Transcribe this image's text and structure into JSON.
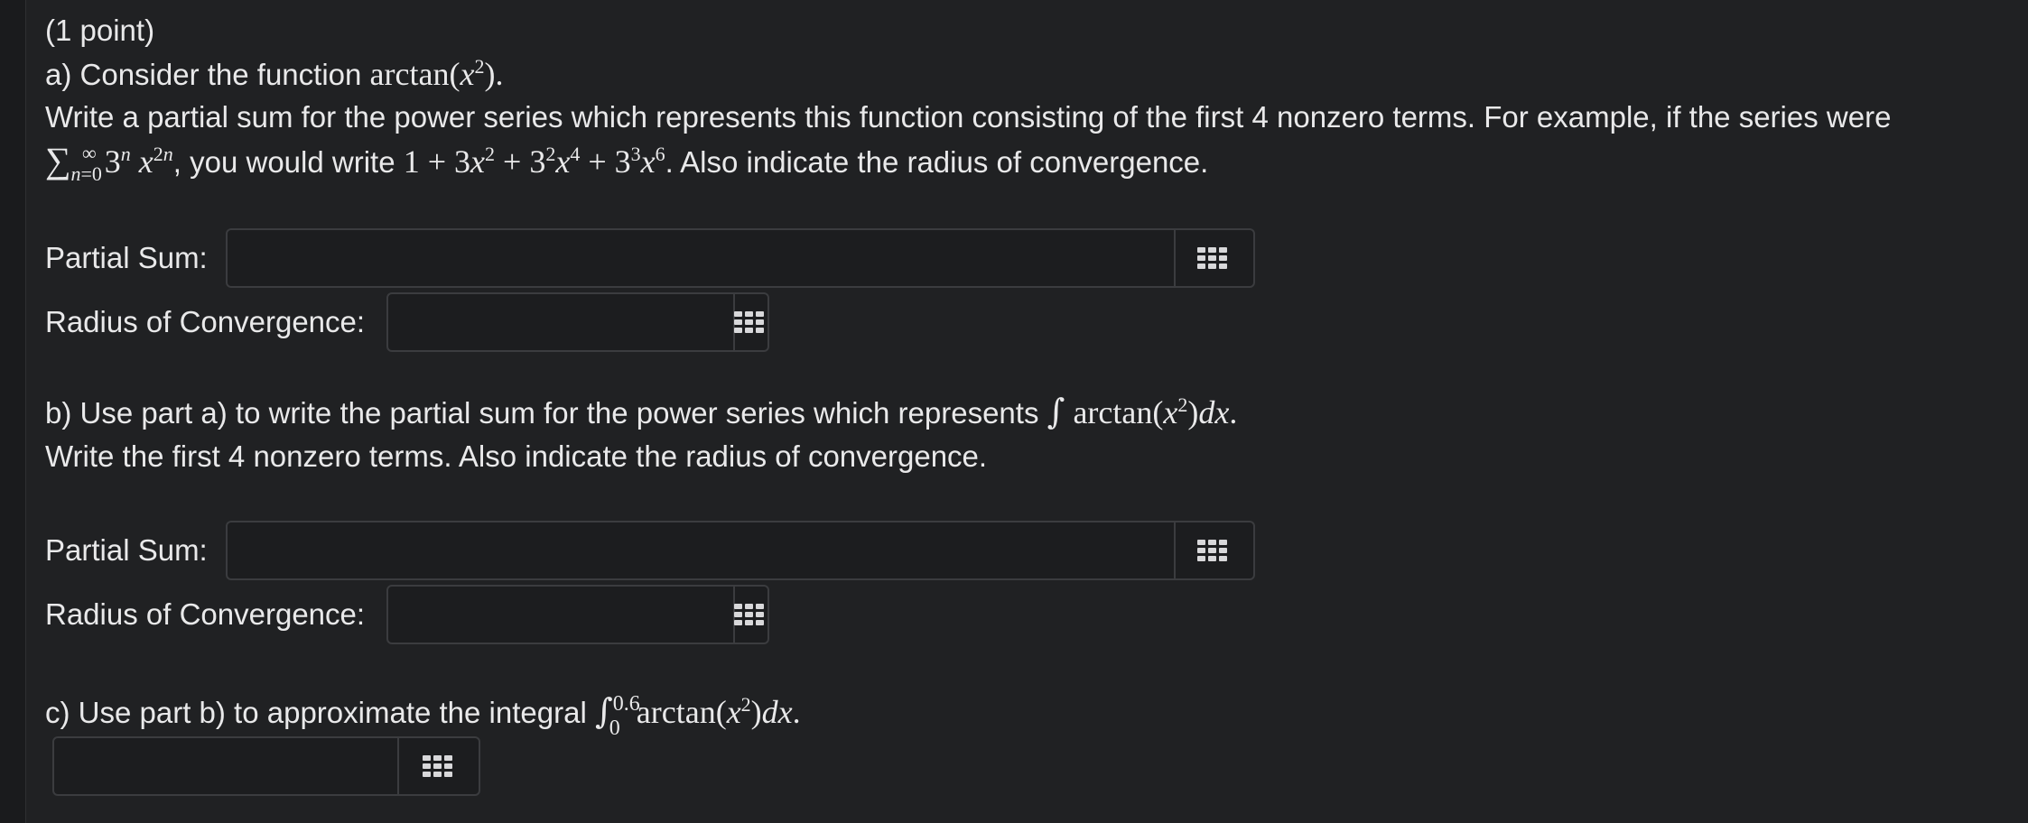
{
  "problem": {
    "points": "(1 point)",
    "part_a": {
      "intro_text": "a) Consider the function ",
      "function_expr": "arctan(x²).",
      "instruction_text": "Write a partial sum for the power series which represents this function consisting of the first 4 nonzero terms. For example, if the series were",
      "example_sum": "∑n=0∞ 3ⁿx²ⁿ",
      "example_text_mid": ", you would write ",
      "example_result": "1 + 3x² + 3²x⁴ + 3³x⁶",
      "example_text_end": ". Also indicate the radius of convergence.",
      "partial_sum_label": "Partial Sum:",
      "radius_label": "Radius of Convergence:"
    },
    "part_b": {
      "intro_text": "b) Use part a) to write the partial sum for the power series which represents ",
      "integral_expr": "∫ arctan(x²)dx.",
      "instruction_text": "Write the first 4 nonzero terms. Also indicate the radius of convergence.",
      "partial_sum_label": "Partial Sum:",
      "radius_label": "Radius of Convergence:"
    },
    "part_c": {
      "intro_text": "c) Use part b) to approximate the integral ",
      "integral_expr": "∫₀^0.6 arctan(x²)dx."
    }
  },
  "answers": {
    "a_partial_sum": "",
    "a_radius": "",
    "b_partial_sum": "",
    "b_radius": "",
    "c_value": ""
  },
  "icons": {
    "equation_editor": "keypad-grid-icon"
  },
  "colors": {
    "background": "#202123",
    "text": "#e9e9ea",
    "border": "#3b3c3f",
    "icon": "#d8d8da"
  }
}
